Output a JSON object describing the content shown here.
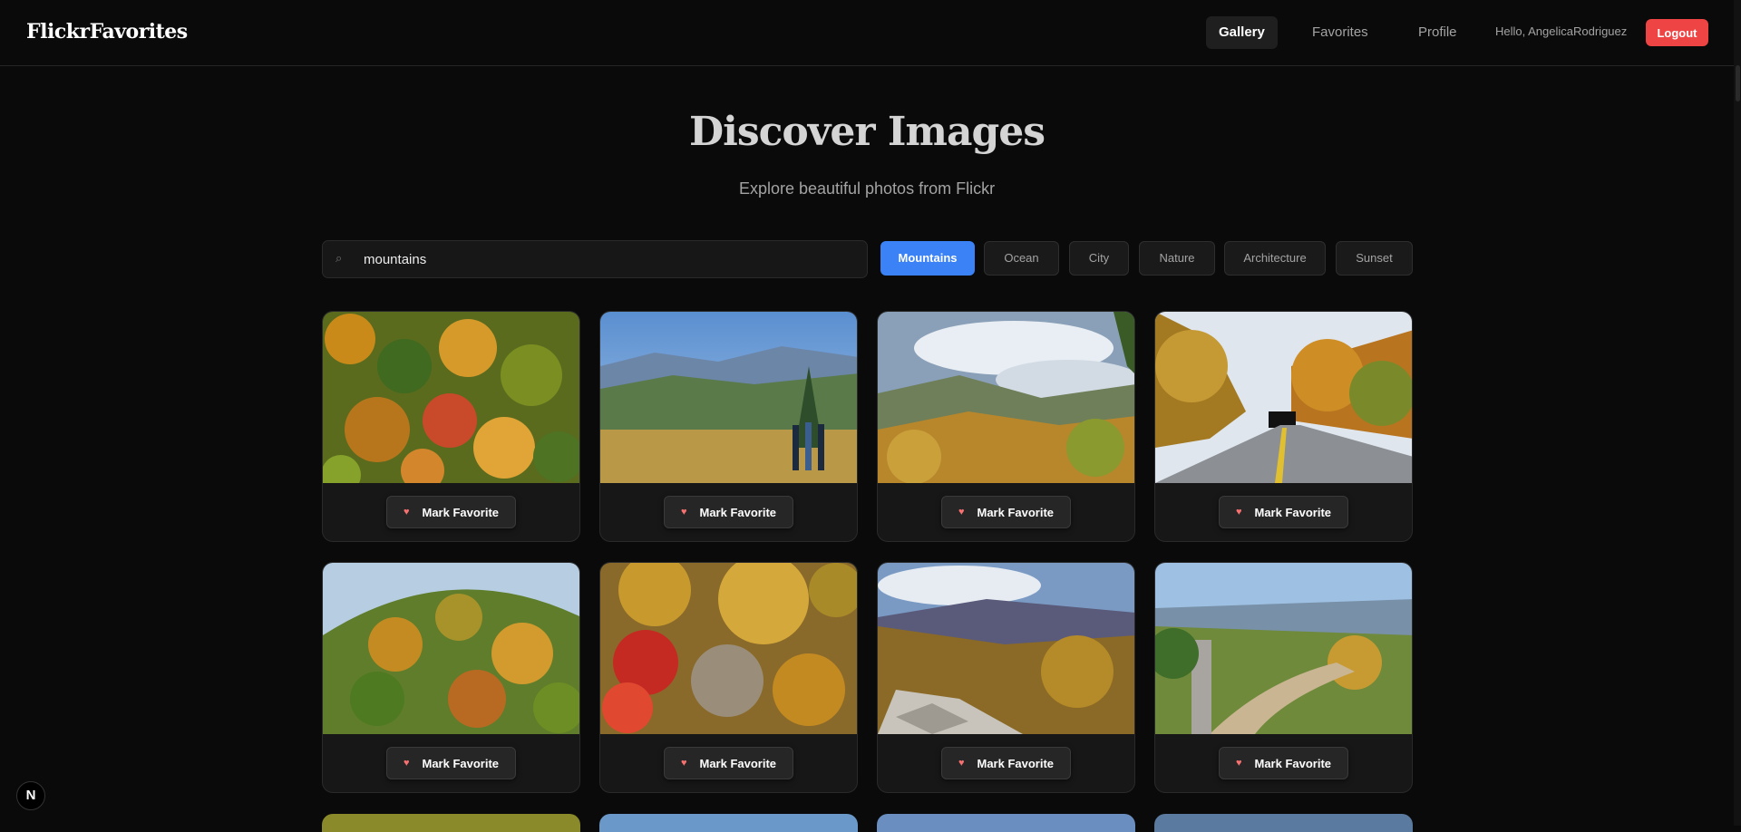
{
  "header": {
    "logo": "FlickrFavorites",
    "nav": [
      {
        "label": "Gallery",
        "active": true
      },
      {
        "label": "Favorites",
        "active": false
      },
      {
        "label": "Profile",
        "active": false
      }
    ],
    "greeting": "Hello, AngelicaRodriguez",
    "logout_label": "Logout"
  },
  "hero": {
    "title": "Discover Images",
    "subtitle": "Explore beautiful photos from Flickr"
  },
  "search": {
    "value": "mountains",
    "icon": "search-icon"
  },
  "categories": [
    {
      "label": "Mountains",
      "active": true
    },
    {
      "label": "Ocean",
      "active": false
    },
    {
      "label": "City",
      "active": false
    },
    {
      "label": "Nature",
      "active": false
    },
    {
      "label": "Architecture",
      "active": false
    },
    {
      "label": "Sunset",
      "active": false
    }
  ],
  "cards": {
    "button_label": "Mark Favorite",
    "button_icon": "heart-icon",
    "photos": [
      "Autumn forest canopy",
      "Hikers at mountain overlook",
      "Misty mountain valley",
      "Road toward mountain tunnel",
      "Colorful forested hillside",
      "Red and yellow autumn trees",
      "Rocky ledge over valley",
      "Trail marker at overlook"
    ]
  },
  "colors": {
    "accent": "#3b82f6",
    "logout": "#ef4444",
    "heart": "#f87171"
  }
}
